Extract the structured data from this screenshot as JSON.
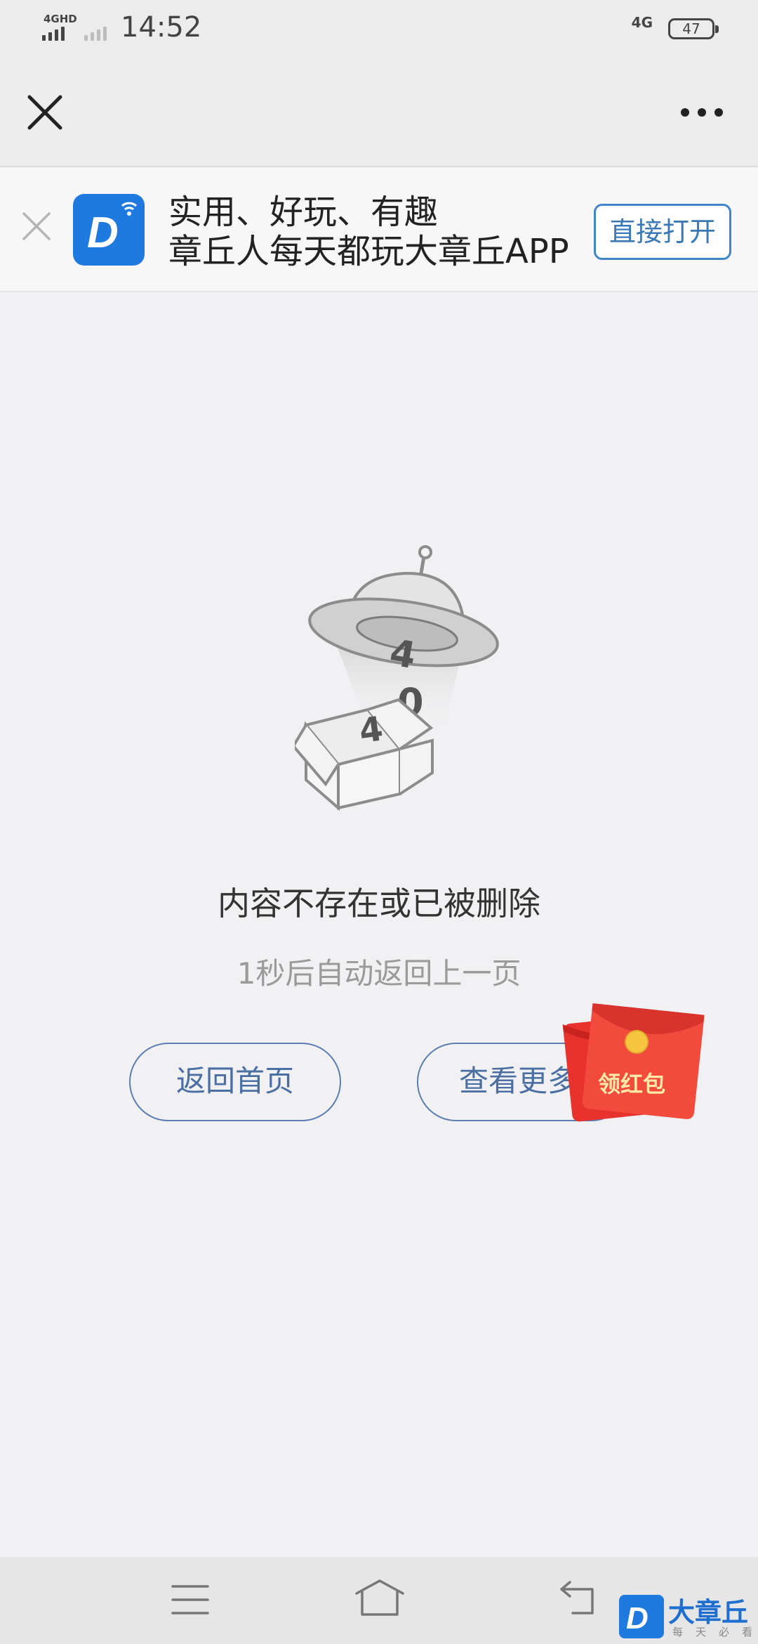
{
  "status_bar": {
    "network_left": "4GHD",
    "time": "14:52",
    "network_right": "4G",
    "battery": "47"
  },
  "nav": {
    "close_icon": "close-icon",
    "more_icon": "more-icon"
  },
  "app_banner": {
    "line1": "实用、好玩、有趣",
    "line2": "章丘人每天都玩大章丘APP",
    "open_button": "直接打开",
    "app_icon_letter": "D",
    "accent_color": "#1f7ae0"
  },
  "error": {
    "illustration_digits": [
      "4",
      "0",
      "4"
    ],
    "title": "内容不存在或已被删除",
    "subtitle": "1秒后自动返回上一页"
  },
  "buttons": {
    "home": "返回首页",
    "more": "查看更多"
  },
  "red_packet": {
    "label": "领红包"
  },
  "watermark": {
    "logo_letter": "D",
    "name": "大章丘",
    "slogan": "每天必看"
  }
}
